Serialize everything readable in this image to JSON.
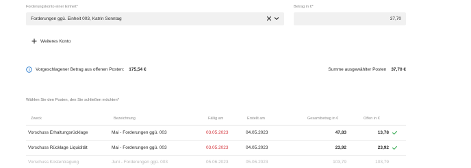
{
  "form": {
    "account_label": "Forderungskonto einer Einheit*",
    "account_value": "Forderungen ggü. Einheit 003, Katrin Sonntag",
    "amount_label": "Betrag in €*",
    "amount_value": "37,70",
    "add_account_label": "Weiteres Konto"
  },
  "summary": {
    "suggested_label": "Vorgeschlagener Betrag aus offenen Posten:",
    "suggested_amount": "175,54 €",
    "selected_label": "Summe ausgewählter Posten",
    "selected_amount": "37,70 €"
  },
  "table": {
    "instruction": "Wählen Sie den Posten, den Sie schließen möchten*",
    "headers": {
      "zweck": "Zweck",
      "bezeichnung": "Bezeichnung",
      "faellig": "Fällig am",
      "erstellt": "Erstellt am",
      "gesamt": "Gesamtbetrag in €",
      "offen": "Offen in €"
    },
    "rows": [
      {
        "zweck": "Vorschuss Erhaltungsrücklage",
        "bezeichnung": "Mai - Forderungen ggü. 003",
        "faellig": "03.05.2023",
        "erstellt": "04.05.2023",
        "gesamt": "47,83",
        "offen": "13,78"
      },
      {
        "zweck": "Vorschuss Rücklage Liquidität",
        "bezeichnung": "Mai - Forderungen ggü. 003",
        "faellig": "03.05.2023",
        "erstellt": "04.05.2023",
        "gesamt": "23,92",
        "offen": "23,92"
      },
      {
        "zweck": "Vorschuss Kostentragung",
        "bezeichnung": "Juni - Forderungen ggü. 003",
        "faellig": "05.06.2023",
        "erstellt": "05.06.2023",
        "gesamt": "103,79",
        "offen": "103,79"
      }
    ]
  },
  "colors": {
    "overdue": "#d3343b",
    "check": "#3fae5a",
    "info": "#2f7fd0"
  }
}
